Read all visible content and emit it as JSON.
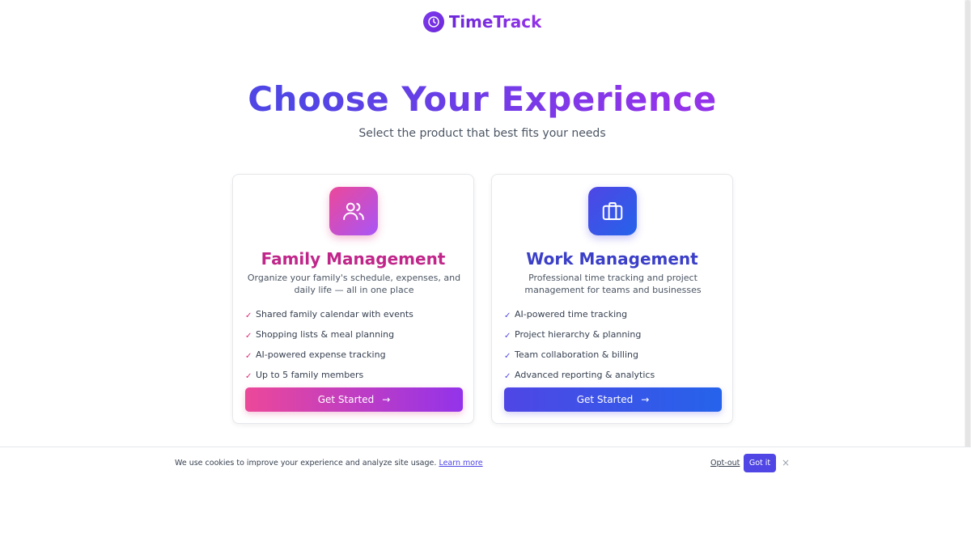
{
  "brand": {
    "name": "TimeTrack",
    "icon": "clock-icon",
    "color": "#6d28d9"
  },
  "hero": {
    "title": "Choose Your Experience",
    "subtitle": "Select the product that best fits your needs"
  },
  "cards": {
    "family": {
      "icon": "users-icon",
      "title": "Family Management",
      "description": "Organize your family's schedule, expenses, and daily life — all in one place",
      "features": [
        "Shared family calendar with events",
        "Shopping lists & meal planning",
        "AI-powered expense tracking",
        "Up to 5 family members"
      ],
      "cta_label": "Get Started",
      "accent": "#db2777"
    },
    "work": {
      "icon": "briefcase-icon",
      "title": "Work Management",
      "description": "Professional time tracking and project management for teams and businesses",
      "features": [
        "AI-powered time tracking",
        "Project hierarchy & planning",
        "Team collaboration & billing",
        "Advanced reporting & analytics"
      ],
      "cta_label": "Get Started",
      "accent": "#4f46e5"
    }
  },
  "check_glyph": "✓",
  "arrow_glyph": "→",
  "cookie": {
    "message": "We use cookies to improve your experience and analyze site usage.",
    "learn_more": "Learn more",
    "opt_out": "Opt-out",
    "accept": "Got it",
    "close": "×"
  }
}
